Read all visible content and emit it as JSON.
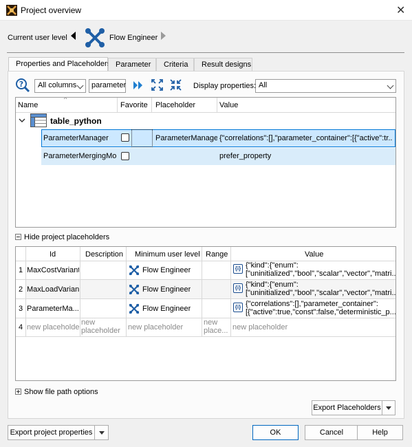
{
  "window": {
    "title": "Project overview",
    "close_glyph": "✕",
    "app_icon": "app-icon"
  },
  "userlevel": {
    "label": "Current user level",
    "value": "Flow Engineer"
  },
  "tabs": [
    "Properties and Placeholders",
    "Parameter",
    "Criteria",
    "Result designs"
  ],
  "toolbar": {
    "columns_select": "All columns",
    "search_value": "parameter",
    "display_label": "Display properties:",
    "display_select": "All"
  },
  "props_table": {
    "headers": [
      "Name",
      "Favorite",
      "Placeholder",
      "Value"
    ],
    "group": "table_python",
    "rows": [
      {
        "name": "ParameterManager",
        "favorite": false,
        "placeholder": "ParameterManager",
        "value": "{\"correlations\":[],\"parameter_container\":[{\"active\":tr..."
      },
      {
        "name": "ParameterMergingMode",
        "favorite": false,
        "placeholder": "",
        "value": "prefer_property"
      }
    ]
  },
  "hide_placeholders_label": "Hide project placeholders",
  "ph_table": {
    "headers": [
      "Id",
      "Description",
      "Minimum user level",
      "Range",
      "Value"
    ],
    "rows": [
      {
        "num": "1",
        "id": "MaxCostVariant",
        "description": "",
        "level": "Flow Engineer",
        "range": "",
        "value1": "{\"kind\":{\"enum\":",
        "value2": "[\"uninitialized\",\"bool\",\"scalar\",\"vector\",\"matri..."
      },
      {
        "num": "2",
        "id": "MaxLoadVariant",
        "description": "",
        "level": "Flow Engineer",
        "range": "",
        "value1": "{\"kind\":{\"enum\":",
        "value2": "[\"uninitialized\",\"bool\",\"scalar\",\"vector\",\"matri..."
      },
      {
        "num": "3",
        "id": "ParameterMa...",
        "description": "",
        "level": "Flow Engineer",
        "range": "",
        "value1": "{\"correlations\":[],\"parameter_container\":",
        "value2": "[{\"active\":true,\"const\":false,\"deterministic_p..."
      }
    ],
    "new_row": {
      "num": "4",
      "id": "new placeholder",
      "description1": "new",
      "description2": "placeholder",
      "level": "new placeholder",
      "range1": "new",
      "range2": "place...",
      "value": "new placeholder"
    }
  },
  "file_path_label": "Show file path options",
  "buttons": {
    "export_placeholders": "Export Placeholders",
    "export_properties": "Export project properties",
    "ok": "OK",
    "cancel": "Cancel",
    "help": "Help"
  },
  "colors": {
    "selection": "#cce8ff",
    "selection_border": "#0078d7",
    "row_highlight": "#cce8ff",
    "accent": "#0067c0"
  }
}
